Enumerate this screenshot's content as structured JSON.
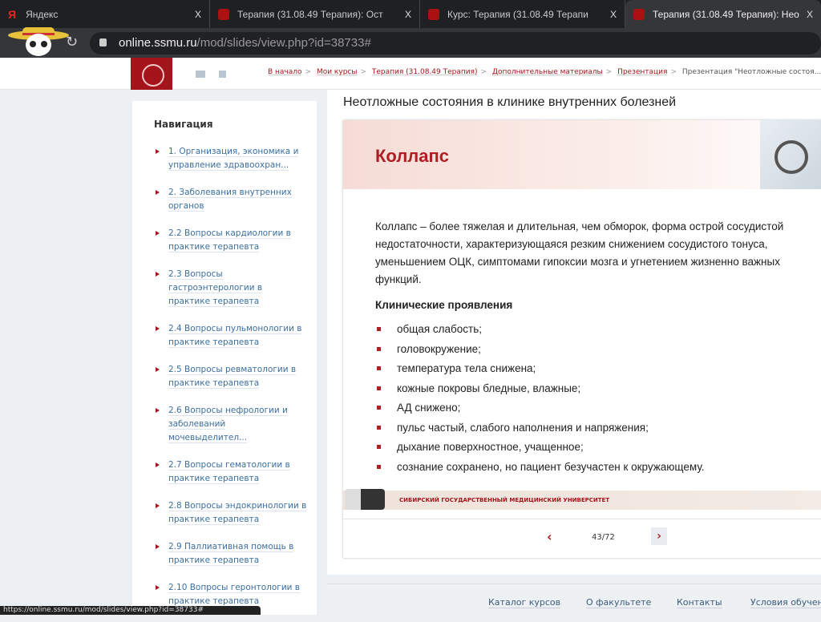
{
  "browser": {
    "tabs": [
      {
        "title": "Яндекс",
        "icon": "yandex-icon"
      },
      {
        "title": "Терапия (31.08.49 Терапия): Ост"
      },
      {
        "title": "Курс: Терапия (31.08.49 Терапи"
      },
      {
        "title": "Терапия (31.08.49 Терапия): Нео"
      }
    ],
    "close": "X",
    "url_host": "online.ssmu.ru",
    "url_path": "/mod/slides/view.php?id=38733#",
    "status": "https://online.ssmu.ru/mod/slides/view.php?id=38733#"
  },
  "breadcrumbs": [
    "В начало",
    "Мои курсы",
    "Терапия (31.08.49 Терапия)",
    "Дополнительные материалы",
    "Презентация"
  ],
  "breadcrumb_current": "Презентация \"Неотложные состоя...",
  "sep": ">",
  "sidebar": {
    "title": "Навигация",
    "items": [
      "1. Организация, экономика и управление здравоохран...",
      "2. Заболевания внутренних органов",
      "2.2 Вопросы кардиологии в практике терапевта",
      "2.3 Вопросы гастроэнтерологии в практике терапевта",
      "2.4 Вопросы пульмонологии в практике терапевта",
      "2.5 Вопросы ревматологии в практике терапевта",
      "2.6 Вопросы нефрологии и заболеваний мочевыделител...",
      "2.7 Вопросы гематологии в практике терапевта",
      "2.8 Вопросы эндокринологии в практике терапевта",
      "2.9 Паллиативная помощь в практике терапевта",
      "2.10 Вопросы геронтологии в практике терапевта"
    ]
  },
  "page_title": "Неотложные состояния в клинике внутренних болезней",
  "slide": {
    "title": "Коллапс",
    "text": "Коллапс – более тяжелая и длительная, чем обморок, форма острой сосудистой недостаточности, характеризующаяся резким снижением сосудистого тонуса, уменьшением ОЦК, симптомами гипоксии мозга и угнетением жизненно важных функций.",
    "subtitle": "Клинические проявления",
    "bullets": [
      "общая слабость;",
      "головокружение;",
      "температура тела снижена;",
      "кожные покровы бледные, влажные;",
      "АД снижено;",
      "пульс частый, слабого наполнения и напряжения;",
      "дыхание поверхностное, учащенное;",
      "сознание сохранено, но пациент безучастен к окружающему."
    ],
    "footer": "СИБИРСКИЙ ГОСУДАРСТВЕННЫЙ МЕДИЦИНСКИЙ УНИВЕРСИТЕТ"
  },
  "pager": {
    "prev": "‹",
    "next": "›",
    "current": 43,
    "total": 72,
    "label": "43/72"
  },
  "footer": [
    "Каталог курсов",
    "О факультете",
    "Контакты",
    "Условия обучения"
  ]
}
